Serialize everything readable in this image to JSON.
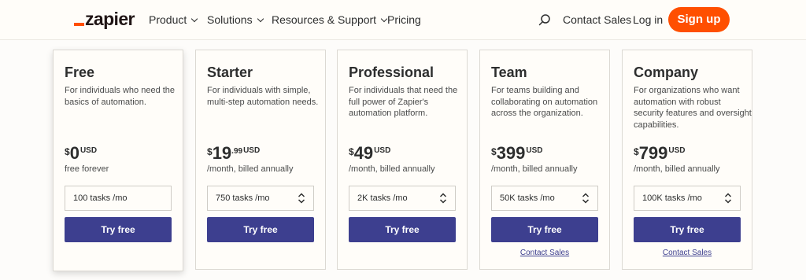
{
  "nav": {
    "logo": "zapier",
    "items": [
      {
        "label": "Product",
        "dropdown": true
      },
      {
        "label": "Solutions",
        "dropdown": true
      },
      {
        "label": "Resources & Support",
        "dropdown": true
      },
      {
        "label": "Pricing",
        "dropdown": false
      }
    ],
    "contact_sales": "Contact Sales",
    "login": "Log in",
    "signup": "Sign up",
    "accent_color": "#ff4f00"
  },
  "plans": [
    {
      "name": "Free",
      "description": "For individuals who need the basics of automation.",
      "currency": "$",
      "amount": "0",
      "cents": "",
      "unit": "USD",
      "billing": "free forever",
      "tasks": "100 tasks /mo",
      "tasks_selectable": false,
      "cta": "Try free",
      "contact_link": ""
    },
    {
      "name": "Starter",
      "description": "For individuals with simple, multi-step automation needs.",
      "currency": "$",
      "amount": "19",
      "cents": ".99",
      "unit": "USD",
      "billing": "/month, billed annually",
      "tasks": "750 tasks /mo",
      "tasks_selectable": true,
      "cta": "Try free",
      "contact_link": ""
    },
    {
      "name": "Professional",
      "description": "For individuals that need the full power of Zapier's automation platform.",
      "currency": "$",
      "amount": "49",
      "cents": "",
      "unit": "USD",
      "billing": "/month, billed annually",
      "tasks": "2K tasks /mo",
      "tasks_selectable": true,
      "cta": "Try free",
      "contact_link": ""
    },
    {
      "name": "Team",
      "description": "For teams building and collaborating on automation across the organization.",
      "currency": "$",
      "amount": "399",
      "cents": "",
      "unit": "USD",
      "billing": "/month, billed annually",
      "tasks": "50K tasks /mo",
      "tasks_selectable": true,
      "cta": "Try free",
      "contact_link": "Contact Sales"
    },
    {
      "name": "Company",
      "description": "For organizations who want automation with robust security features and oversight capabilities.",
      "currency": "$",
      "amount": "799",
      "cents": "",
      "unit": "USD",
      "billing": "/month, billed annually",
      "tasks": "100K tasks /mo",
      "tasks_selectable": true,
      "cta": "Try free",
      "contact_link": "Contact Sales"
    }
  ],
  "button_color": "#3d3f8f"
}
